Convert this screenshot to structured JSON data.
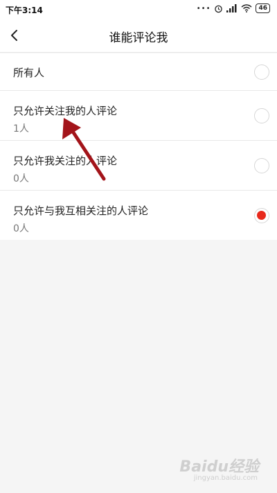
{
  "status_bar": {
    "time": "下午3:14",
    "dots": "•••",
    "battery": "46"
  },
  "header": {
    "title": "谁能评论我"
  },
  "options": [
    {
      "label": "所有人",
      "count": "",
      "selected": false
    },
    {
      "label": "只允许关注我的人评论",
      "count": "1人",
      "selected": false
    },
    {
      "label": "只允许我关注的人评论",
      "count": "0人",
      "selected": false
    },
    {
      "label": "只允许与我互相关注的人评论",
      "count": "0人",
      "selected": true
    }
  ],
  "colors": {
    "selected_radio": "#e8291c",
    "annotation_arrow": "#a3141a"
  },
  "watermark": {
    "logo": "Baidu经验",
    "url": "jingyan.baidu.com"
  }
}
